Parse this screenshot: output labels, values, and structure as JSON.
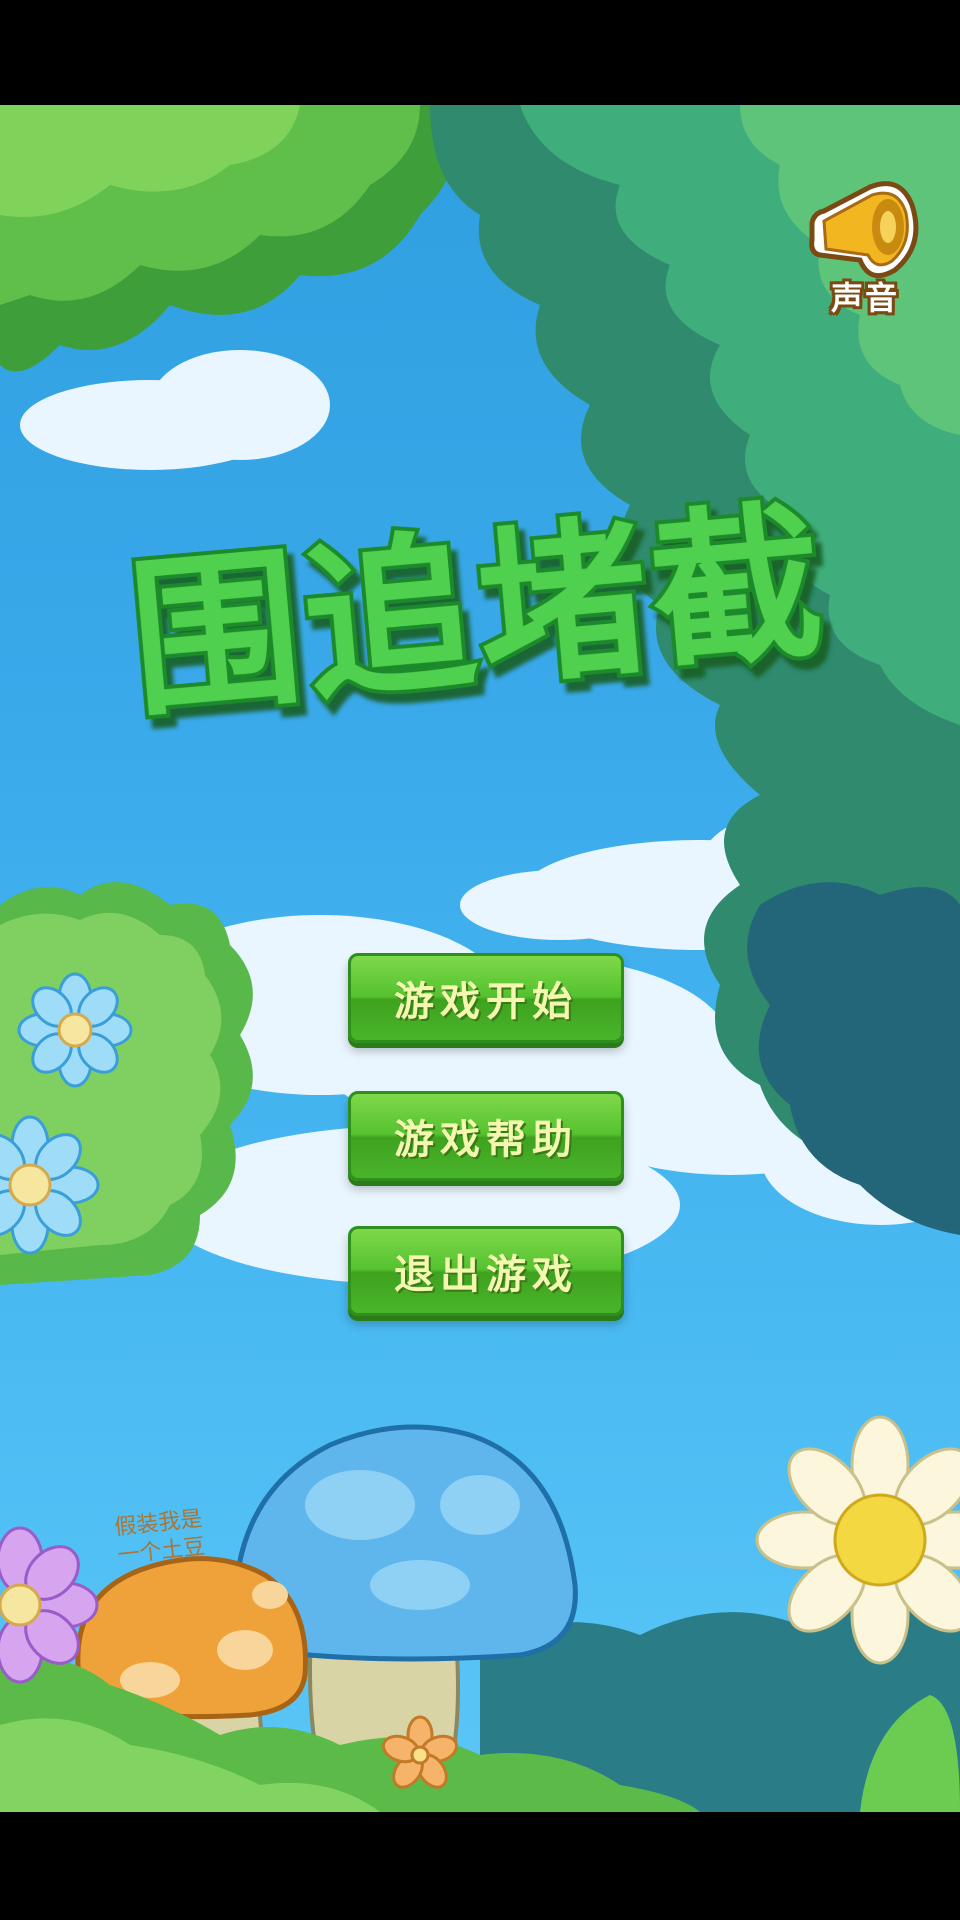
{
  "game": {
    "title": "围追堵截",
    "sound_label": "声音",
    "menu": [
      {
        "label": "游戏开始"
      },
      {
        "label": "游戏帮助"
      },
      {
        "label": "退出游戏"
      }
    ],
    "mushroom_text_line1": "假装我是",
    "mushroom_text_line2": "一个土豆"
  },
  "colors": {
    "sky": "#3aa9ea",
    "title_fill": "#4fd04f",
    "title_outline": "#1f8a2a",
    "button_green": "#55c22f",
    "button_text": "#f3f7b0",
    "sound_gold": "#f2b620"
  },
  "icons": [
    "speaker-icon"
  ]
}
